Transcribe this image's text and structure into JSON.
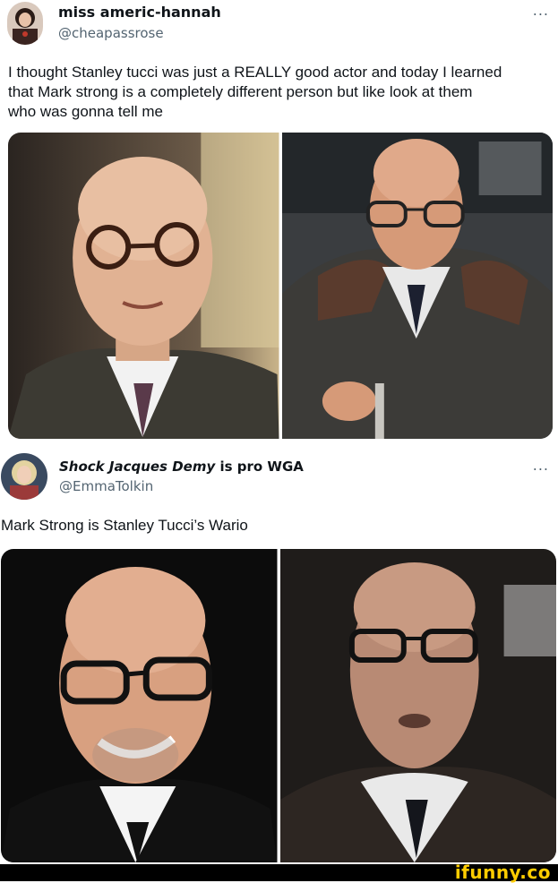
{
  "tweets": [
    {
      "display_name": "miss americ-hannah",
      "handle": "@cheapassrose",
      "text": "I thought Stanley tucci was just a REALLY good actor and today I learned\nthat Mark strong is a completely different person but like look at them\nwho was gonna tell me",
      "more_label": "...",
      "photos": [
        "photo-stanley-tucci",
        "photo-mark-strong"
      ]
    },
    {
      "display_name_italic": "Shock Jacques Demy",
      "display_name_suffix": " is pro WGA",
      "handle": "@EmmaTolkin",
      "text": "Mark Strong is Stanley Tucci’s Wario",
      "more_label": "...",
      "photos": [
        "photo-stanley-tucci-smiling",
        "photo-mark-strong-glasses"
      ]
    }
  ],
  "watermark": "ifunny.co",
  "colors": {
    "handle": "#536471",
    "watermark": "#ffcc00",
    "footer": "#000000"
  }
}
